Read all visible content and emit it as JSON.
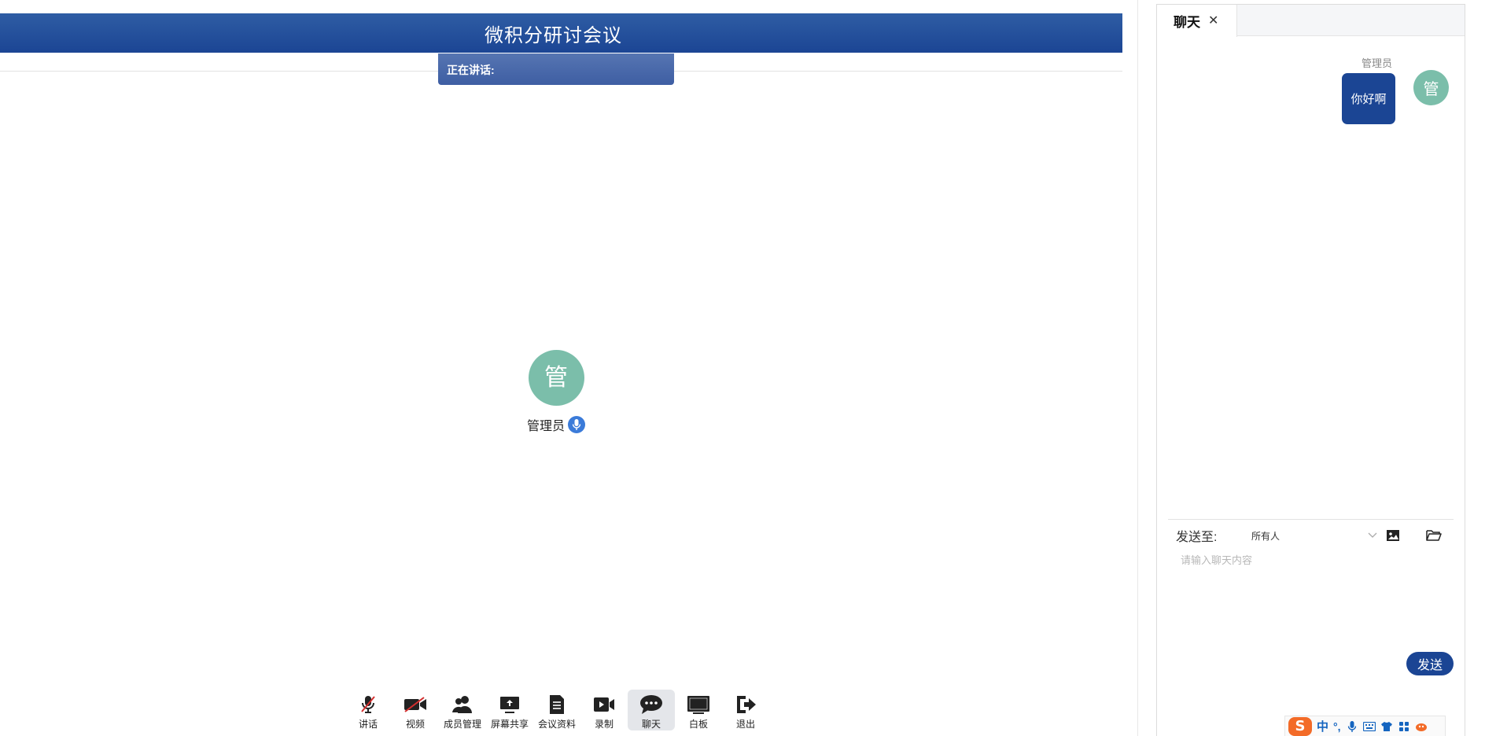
{
  "meeting": {
    "title": "微积分研讨会议",
    "speaking_label": "正在讲话:",
    "presenter_avatar_char": "管",
    "presenter_name": "管理员"
  },
  "toolbar": {
    "items": [
      {
        "label": "讲话",
        "icon": "mic-off-icon",
        "active": false
      },
      {
        "label": "视频",
        "icon": "video-off-icon",
        "active": false
      },
      {
        "label": "成员管理",
        "icon": "members-icon",
        "active": false
      },
      {
        "label": "屏幕共享",
        "icon": "screen-share-icon",
        "active": false
      },
      {
        "label": "会议资料",
        "icon": "document-icon",
        "active": false
      },
      {
        "label": "录制",
        "icon": "record-icon",
        "active": false
      },
      {
        "label": "聊天",
        "icon": "chat-icon",
        "active": true
      },
      {
        "label": "白板",
        "icon": "whiteboard-icon",
        "active": false
      },
      {
        "label": "退出",
        "icon": "exit-icon",
        "active": false
      }
    ]
  },
  "chat": {
    "tab_label": "聊天",
    "close_symbol": "✕",
    "messages": [
      {
        "sender": "管理员",
        "avatar_char": "管",
        "text": "你好啊"
      }
    ],
    "send_to_label": "发送至:",
    "send_to_value": "所有人",
    "input_placeholder": "请输入聊天内容",
    "send_button": "发送"
  },
  "ime": {
    "logo": "S",
    "mode": "中",
    "punct": "°,"
  },
  "colors": {
    "header_blue": "#1b4594",
    "avatar_green": "#7bbeaa",
    "ime_orange": "#f36b28"
  }
}
